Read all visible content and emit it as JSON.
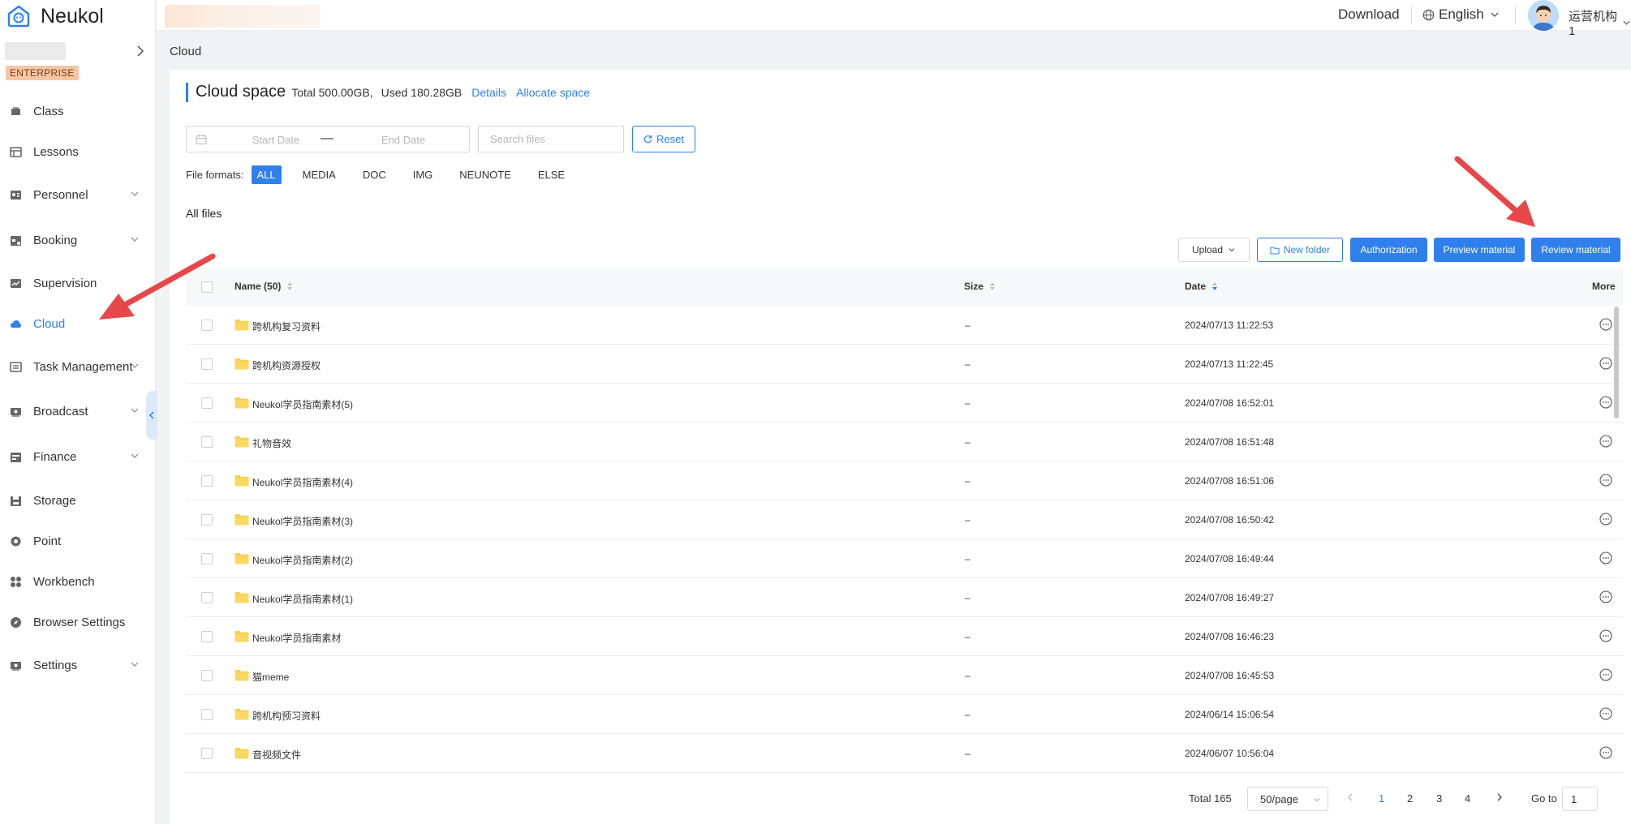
{
  "brand": {
    "name": "Neukol"
  },
  "sidebar": {
    "badge": "ENTERPRISE",
    "items": [
      {
        "label": "Class",
        "icon": "class-icon",
        "caret": false
      },
      {
        "label": "Lessons",
        "icon": "lessons-icon",
        "caret": false
      },
      {
        "label": "Personnel",
        "icon": "personnel-icon",
        "caret": true
      },
      {
        "label": "Booking",
        "icon": "booking-icon",
        "caret": true
      },
      {
        "label": "Supervision",
        "icon": "supervision-icon",
        "caret": false
      },
      {
        "label": "Cloud",
        "icon": "cloud-icon",
        "caret": false,
        "active": true
      },
      {
        "label": "Task Management",
        "icon": "task-icon",
        "caret": true
      },
      {
        "label": "Broadcast",
        "icon": "broadcast-icon",
        "caret": true
      },
      {
        "label": "Finance",
        "icon": "finance-icon",
        "caret": true
      },
      {
        "label": "Storage",
        "icon": "storage-icon",
        "caret": false
      },
      {
        "label": "Point",
        "icon": "point-icon",
        "caret": false
      },
      {
        "label": "Workbench",
        "icon": "workbench-icon",
        "caret": false
      },
      {
        "label": "Browser Settings",
        "icon": "browser-settings-icon",
        "caret": false
      },
      {
        "label": "Settings",
        "icon": "settings-icon",
        "caret": true
      }
    ]
  },
  "topbar": {
    "download": "Download",
    "language": "English",
    "user": "运营机构1"
  },
  "breadcrumb": "Cloud",
  "cloud_space": {
    "title": "Cloud space",
    "total": "Total 500.00GB,",
    "used": "Used 180.28GB",
    "details": "Details",
    "allocate": "Allocate space"
  },
  "filters": {
    "start_date": "Start Date",
    "end_date": "End Date",
    "search_placeholder": "Search files",
    "reset": "Reset",
    "formats_label": "File formats:",
    "formats": [
      "ALL",
      "MEDIA",
      "DOC",
      "IMG",
      "NEUNOTE",
      "ELSE"
    ],
    "selected_format": "ALL"
  },
  "all_files": "All files",
  "actions": {
    "upload": "Upload",
    "new_folder": "New folder",
    "authorization": "Authorization",
    "preview": "Preview material",
    "review": "Review material"
  },
  "table": {
    "headers": {
      "name": "Name (50)",
      "size": "Size",
      "date": "Date",
      "more": "More"
    },
    "rows": [
      {
        "name": "跨机构复习资料",
        "size": "–",
        "date": "2024/07/13 11:22:53"
      },
      {
        "name": "跨机构资源授权",
        "size": "–",
        "date": "2024/07/13 11:22:45"
      },
      {
        "name": "Neukol学员指南素材(5)",
        "size": "–",
        "date": "2024/07/08 16:52:01"
      },
      {
        "name": "礼物音效",
        "size": "–",
        "date": "2024/07/08 16:51:48"
      },
      {
        "name": "Neukol学员指南素材(4)",
        "size": "–",
        "date": "2024/07/08 16:51:06"
      },
      {
        "name": "Neukol学员指南素材(3)",
        "size": "–",
        "date": "2024/07/08 16:50:42"
      },
      {
        "name": "Neukol学员指南素材(2)",
        "size": "–",
        "date": "2024/07/08 16:49:44"
      },
      {
        "name": "Neukol学员指南素材(1)",
        "size": "–",
        "date": "2024/07/08 16:49:27"
      },
      {
        "name": "Neukol学员指南素材",
        "size": "–",
        "date": "2024/07/08 16:46:23"
      },
      {
        "name": "猫meme",
        "size": "–",
        "date": "2024/07/08 16:45:53"
      },
      {
        "name": "跨机构预习资料",
        "size": "–",
        "date": "2024/06/14 15:06:54"
      },
      {
        "name": "音视频文件",
        "size": "–",
        "date": "2024/06/07 10:56:04"
      }
    ]
  },
  "pagination": {
    "total": "Total 165",
    "page_size": "50/page",
    "pages": [
      "1",
      "2",
      "3",
      "4"
    ],
    "current": "1",
    "goto_label": "Go to",
    "goto_value": "1"
  },
  "colors": {
    "accent": "#2f80ed",
    "annotation": "#e8474a",
    "folder": "#f9cf4a"
  }
}
